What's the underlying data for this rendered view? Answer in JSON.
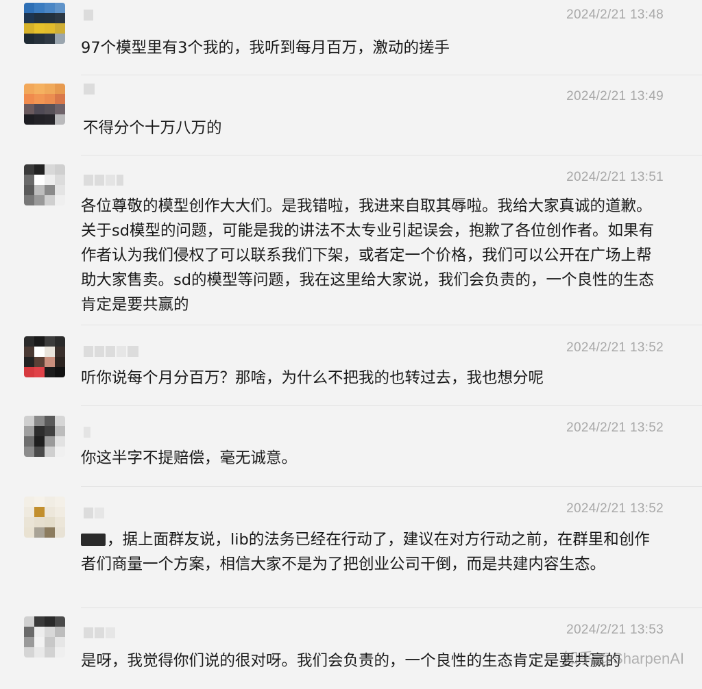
{
  "messages": [
    {
      "time": "2024/2/21 13:48",
      "text": "97个模型里有3个我的，我听到每月百万，激动的搓手"
    },
    {
      "time": "2024/2/21 13:49",
      "text": "不得分个十万八万的"
    },
    {
      "time": "2024/2/21 13:51",
      "text": "各位尊敬的模型创作大大们。是我错啦，我进来自取其辱啦。我给大家真诚的道歉。关于sd模型的问题，可能是我的讲法不太专业引起误会，抱歉了各位创作者。如果有作者认为我们侵权了可以联系我们下架，或者定一个价格，我们可以公开在广场上帮助大家售卖。sd的模型等问题，我在这里给大家说，我们会负责的，一个良性的生态肯定是要共赢的"
    },
    {
      "time": "2024/2/21 13:52",
      "text": "听你说每个月分百万？那啥，为什么不把我的也转过去，我也想分呢"
    },
    {
      "time": "2024/2/21 13:52",
      "text": "你这半字不提赔偿，毫无诚意。"
    },
    {
      "time": "2024/2/21 13:52",
      "text": "，据上面群友说，lib的法务已经在行动了，建议在对方行动之前，在群里和创作者们商量一个方案，相信大家不是为了把创业公司干倒，而是共建内容生态。"
    },
    {
      "time": "2024/2/21 13:53",
      "text": "是呀，我觉得你们说的很对呀。我们会负责的，一个良性的生态肯定是要共赢的"
    }
  ],
  "watermark": "知乎 @SharpenAI",
  "colors": {
    "background": "#f3f3f3",
    "text": "#191919",
    "timestamp": "#a8a8a8",
    "divider": "#e2e2e2"
  }
}
